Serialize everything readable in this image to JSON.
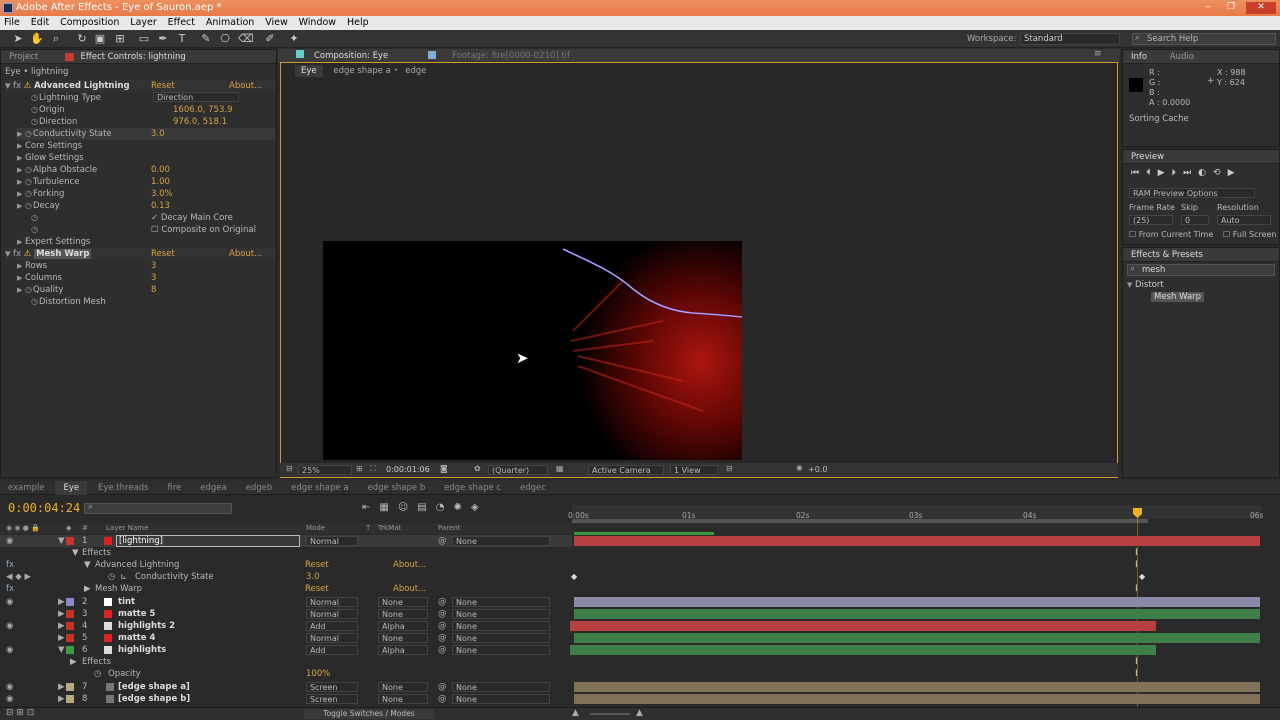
{
  "window": {
    "title": "Adobe After Effects - Eye of Sauron.aep *"
  },
  "menu": [
    "File",
    "Edit",
    "Composition",
    "Layer",
    "Effect",
    "Animation",
    "View",
    "Window",
    "Help"
  ],
  "toolbar": {
    "workspace_label": "Workspace:",
    "workspace_value": "Standard",
    "search_placeholder": "Search Help"
  },
  "left_panel": {
    "tab_project": "Project",
    "tab_effect_controls": "Effect Controls: lightning",
    "breadcrumb": "Eye • lightning",
    "effects": [
      {
        "name": "Advanced Lightning",
        "reset": "Reset",
        "about": "About..."
      },
      {
        "name": "Mesh Warp",
        "reset": "Reset",
        "about": "About..."
      }
    ],
    "props": [
      {
        "label": "Lightning Type",
        "value": "Direction"
      },
      {
        "label": "Origin",
        "value": "1606.0, 753.9"
      },
      {
        "label": "Direction",
        "value": "976.0, 518.1"
      },
      {
        "label": "Conductivity State",
        "value": "3.0"
      },
      {
        "label": "Core Settings",
        "value": ""
      },
      {
        "label": "Glow Settings",
        "value": ""
      },
      {
        "label": "Alpha Obstacle",
        "value": "0.00"
      },
      {
        "label": "Turbulence",
        "value": "1.00"
      },
      {
        "label": "Forking",
        "value": "3.0%"
      },
      {
        "label": "Decay",
        "value": "0.13"
      },
      {
        "label": "Decay Main Core",
        "value": ""
      },
      {
        "label": "Composite on Original",
        "value": ""
      },
      {
        "label": "Expert Settings",
        "value": ""
      }
    ],
    "mesh_props": [
      {
        "label": "Rows",
        "value": "3"
      },
      {
        "label": "Columns",
        "value": "3"
      },
      {
        "label": "Quality",
        "value": "8"
      },
      {
        "label": "Distortion Mesh",
        "value": ""
      }
    ]
  },
  "composition": {
    "tab": "Composition: Eye",
    "footage_tab": "Footage: fire[0000-0210].tif",
    "crumbs": [
      "Eye",
      "edge shape a",
      "edge"
    ],
    "zoom": "25%",
    "timecode": "0:00:01:06",
    "resolution": "(Quarter)",
    "camera": "Active Camera",
    "views": "1 View",
    "exposure": "+0.0"
  },
  "info": {
    "tab": "Info",
    "audio_tab": "Audio",
    "r": "R :",
    "g": "G :",
    "b": "B :",
    "a": "A : 0.0000",
    "x": "X : 988",
    "y": "Y : 624",
    "status": "Sorting Cache"
  },
  "preview": {
    "tab": "Preview",
    "ram": "RAM Preview Options",
    "frame_rate_label": "Frame Rate",
    "skip_label": "Skip",
    "resolution_label": "Resolution",
    "frame_rate": "(25)",
    "skip": "0",
    "resolution": "Auto",
    "from_current": "From Current Time",
    "full_screen": "Full Screen"
  },
  "effects_presets": {
    "tab": "Effects & Presets",
    "search": "mesh",
    "category": "Distort",
    "item": "Mesh Warp"
  },
  "timeline": {
    "tabs": [
      "example",
      "Eye",
      "Eye.threads",
      "fire",
      "edgea",
      "edgeb",
      "edge shape a",
      "edge shape b",
      "edge shape c",
      "edgec"
    ],
    "current_time": "0:00:04:24",
    "ruler": [
      "0:00s",
      "01s",
      "02s",
      "03s",
      "04s",
      "06s"
    ],
    "col_layer": "Layer Name",
    "col_mode": "Mode",
    "col_t": "T",
    "col_trkmat": "TrkMat",
    "col_parent": "Parent",
    "footer": "Toggle Switches / Modes",
    "layers": [
      {
        "num": "1",
        "name": "[lightning]",
        "mode": "Normal",
        "trk": "",
        "parent": "None"
      },
      {
        "num": "2",
        "name": "tint",
        "mode": "Normal",
        "trk": "None",
        "parent": "None"
      },
      {
        "num": "3",
        "name": "matte 5",
        "mode": "Normal",
        "trk": "None",
        "parent": "None"
      },
      {
        "num": "4",
        "name": "highlights 2",
        "mode": "Add",
        "trk": "Alpha",
        "parent": "None"
      },
      {
        "num": "5",
        "name": "matte 4",
        "mode": "Normal",
        "trk": "None",
        "parent": "None"
      },
      {
        "num": "6",
        "name": "highlights",
        "mode": "Add",
        "trk": "Alpha",
        "parent": "None"
      },
      {
        "num": "7",
        "name": "[edge shape a]",
        "mode": "Screen",
        "trk": "None",
        "parent": "None"
      },
      {
        "num": "8",
        "name": "[edge shape b]",
        "mode": "Screen",
        "trk": "None",
        "parent": "None"
      }
    ],
    "sub": {
      "effects": "Effects",
      "adv": "Advanced Lightning",
      "cond": "Conductivity State",
      "cond_val": "3.0",
      "mesh": "Mesh Warp",
      "reset": "Reset",
      "about": "About...",
      "opacity": "Opacity",
      "opacity_val": "100%"
    }
  }
}
